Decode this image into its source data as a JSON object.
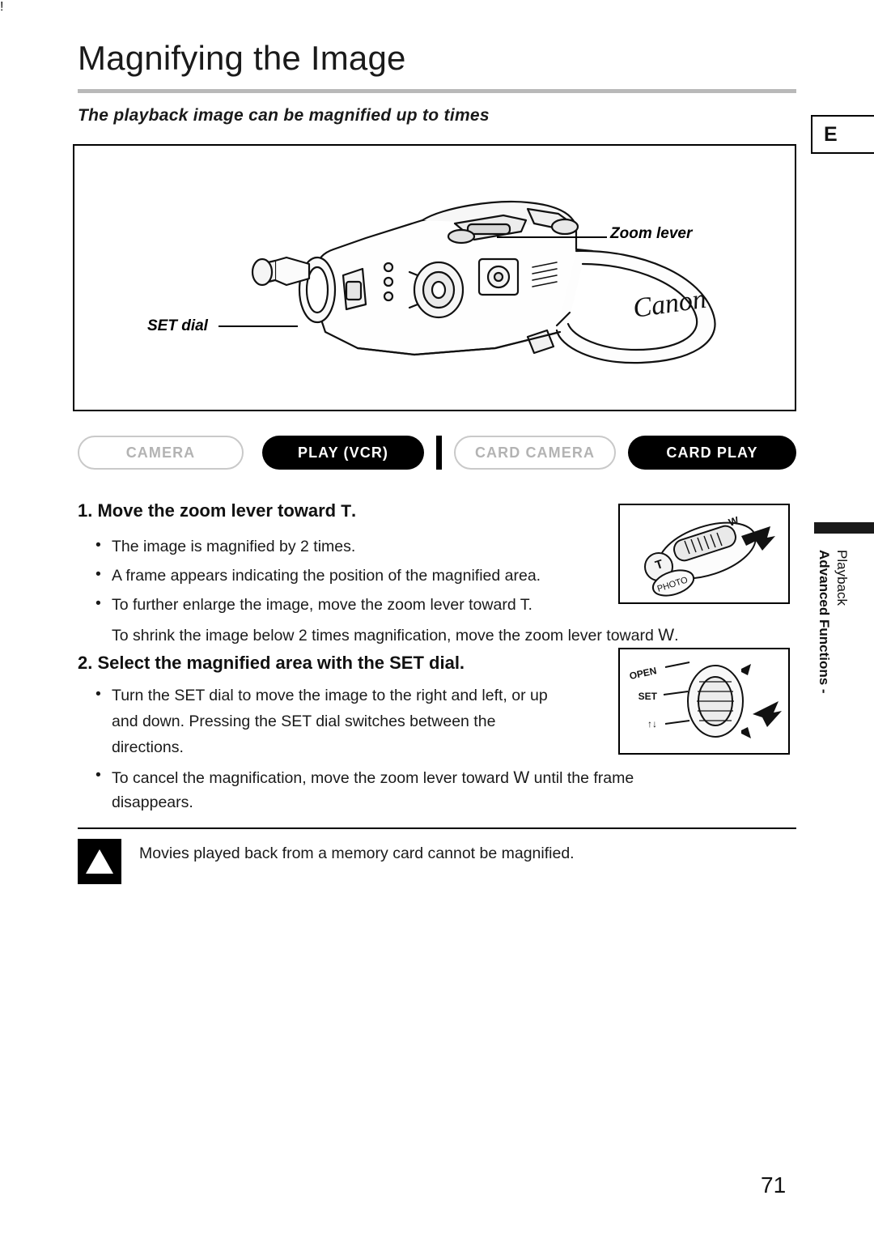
{
  "page": {
    "title": "Magnifying the Image",
    "subtitle": "The playback image can be magnified up to   times",
    "edge_tab": "E",
    "page_number": "71"
  },
  "illustration": {
    "callouts": [
      {
        "name": "zoom-lever",
        "label": "Zoom lever"
      },
      {
        "name": "set-dial",
        "label": "SET dial"
      }
    ],
    "brand": "Canon"
  },
  "modes": [
    {
      "label": "CAMERA",
      "active": false
    },
    {
      "label": "PLAY (VCR)",
      "active": true
    },
    {
      "label": "CARD CAMERA",
      "active": false
    },
    {
      "label": "CARD PLAY",
      "active": true
    }
  ],
  "steps": [
    {
      "number": "1.",
      "heading_before": "Move the zoom lever toward ",
      "heading_symbol": "T",
      "heading_after": ".",
      "bullets": [
        "The image is magnified by 2 times.",
        "A frame appears indicating the position of the magnified area.",
        "To further enlarge the image, move the zoom lever toward T."
      ],
      "note_line_a": "To shrink the image below 2 times magnification, move the zoom lever toward ",
      "note_line_a_symbol": "W",
      "note_line_a_end": "."
    },
    {
      "number": "2.",
      "heading": "Select the magnified area with the SET dial.",
      "bullets": [
        "Turn the SET dial to move the image to the right and left, or up",
        "To cancel the magnification, move the zoom lever toward"
      ],
      "cont_1_line2": "and down. Pressing the SET dial switches between the",
      "cont_1_line3": "directions.",
      "cont_2_symbol": "W",
      "cont_2_rest": "until the frame",
      "cont_2_line2": "disappears."
    }
  ],
  "mini_illustrations": {
    "top": {
      "labels": [
        "W",
        "T",
        "PHOTO"
      ]
    },
    "bottom": {
      "labels": [
        "OPEN",
        "SET",
        "↑↓"
      ]
    }
  },
  "note": {
    "text": "Movies played back from a memory card cannot be magnified.",
    "icon": "warning-icon"
  },
  "side_tab": {
    "line_bold": "Advanced Functions -",
    "line_plain": "Playback"
  },
  "colors": {
    "accent_black": "#000000",
    "inactive_gray": "#b3b3b3",
    "rule_gray": "#b9b9b9"
  }
}
